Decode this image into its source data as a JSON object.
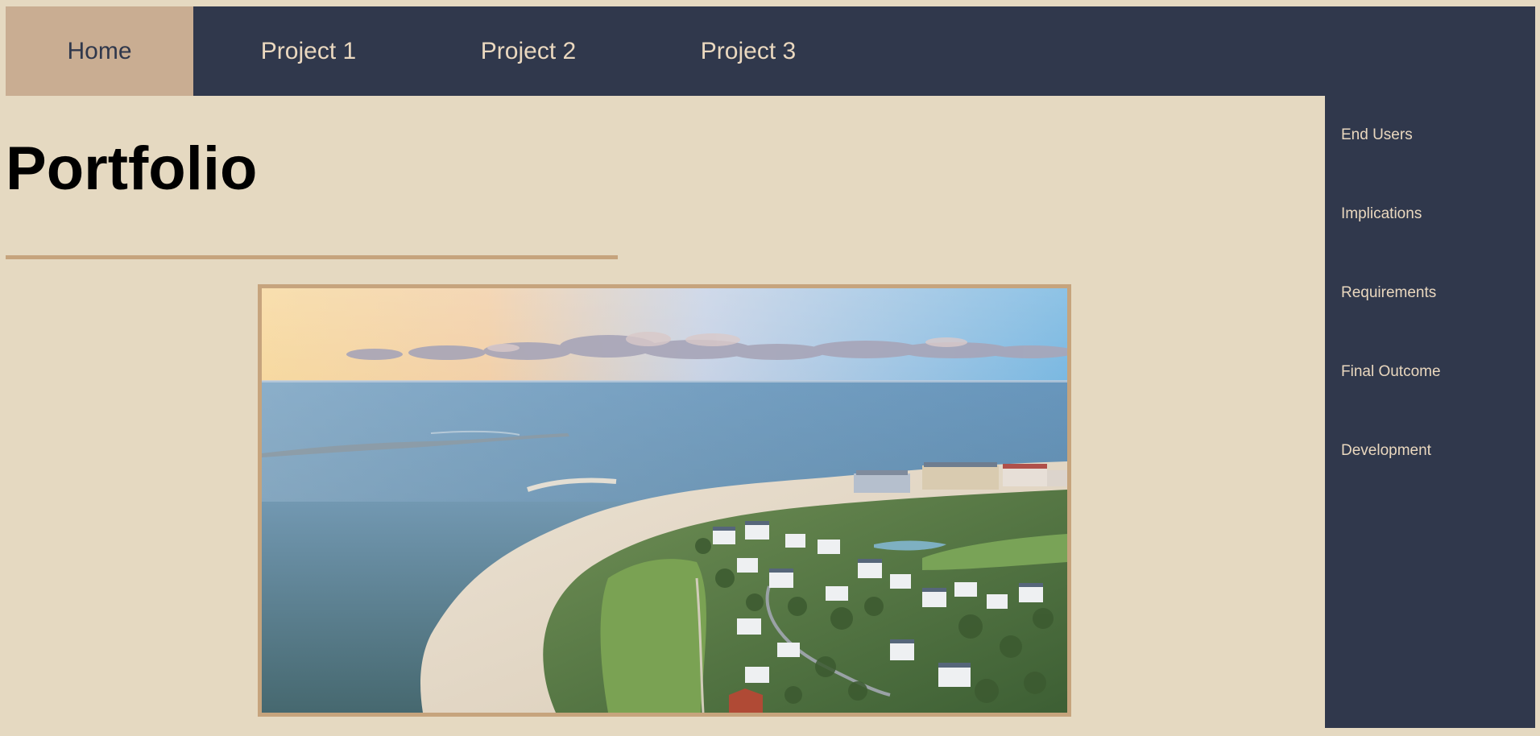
{
  "nav": {
    "items": [
      {
        "label": "Home",
        "active": true
      },
      {
        "label": "Project 1",
        "active": false
      },
      {
        "label": "Project 2",
        "active": false
      },
      {
        "label": "Project 3",
        "active": false
      }
    ]
  },
  "main": {
    "title": "Portfolio"
  },
  "sidebar": {
    "items": [
      {
        "label": "End Users"
      },
      {
        "label": "Implications"
      },
      {
        "label": "Requirements"
      },
      {
        "label": "Final Outcome"
      },
      {
        "label": "Development"
      }
    ]
  },
  "colors": {
    "page_background": "#e5d9c1",
    "nav_background": "#30384c",
    "active_tab": "#c9ad92",
    "accent": "#c6a47d",
    "nav_text": "#ead8bf"
  }
}
